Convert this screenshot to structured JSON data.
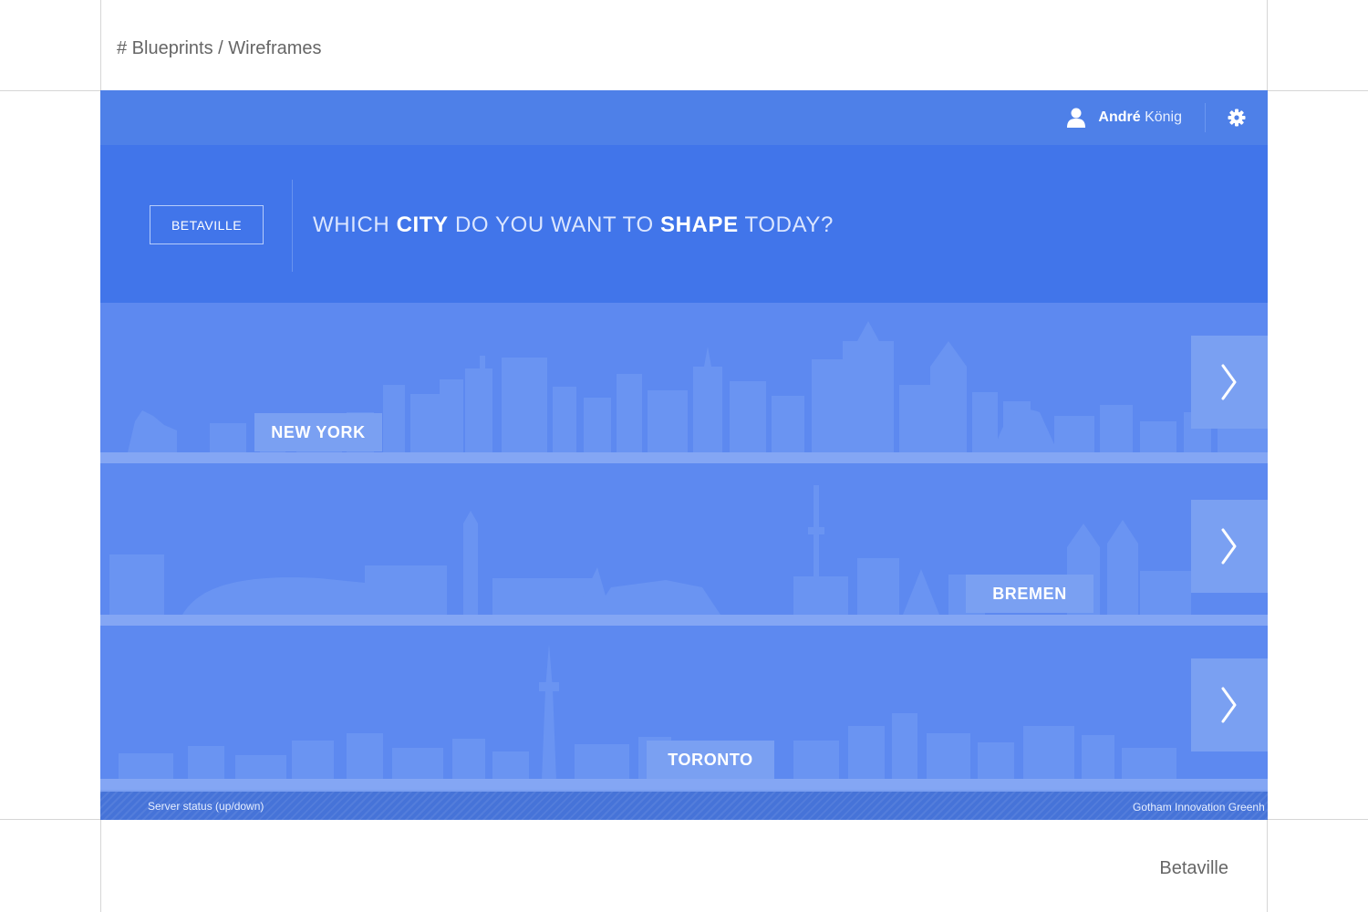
{
  "document": {
    "title": "# Blueprints / Wireframes",
    "footer": "Betaville"
  },
  "header": {
    "user_first_name": "André",
    "user_last_name": "König",
    "user_icon": "user-icon",
    "settings_icon": "gear-icon"
  },
  "hero": {
    "brand_button": "BETAVILLE",
    "headline_part1": "WHICH ",
    "headline_bold1": "CITY",
    "headline_part2": " DO YOU WANT TO ",
    "headline_bold2": "SHAPE",
    "headline_part3": " TODAY?"
  },
  "cities": [
    {
      "label": "NEW YORK",
      "arrow_icon": "chevron-right-icon"
    },
    {
      "label": "BREMEN",
      "arrow_icon": "chevron-right-icon"
    },
    {
      "label": "TORONTO",
      "arrow_icon": "chevron-right-icon"
    }
  ],
  "statusbar": {
    "left": "Server status (up/down)",
    "right": "Gotham Innovation Greenh"
  },
  "colors": {
    "app_background": "#5d89f0",
    "topbar": "#4e80e8",
    "hero": "#4175ea",
    "label_background": "#7aa0f2",
    "statusbar": "#4673d8"
  }
}
